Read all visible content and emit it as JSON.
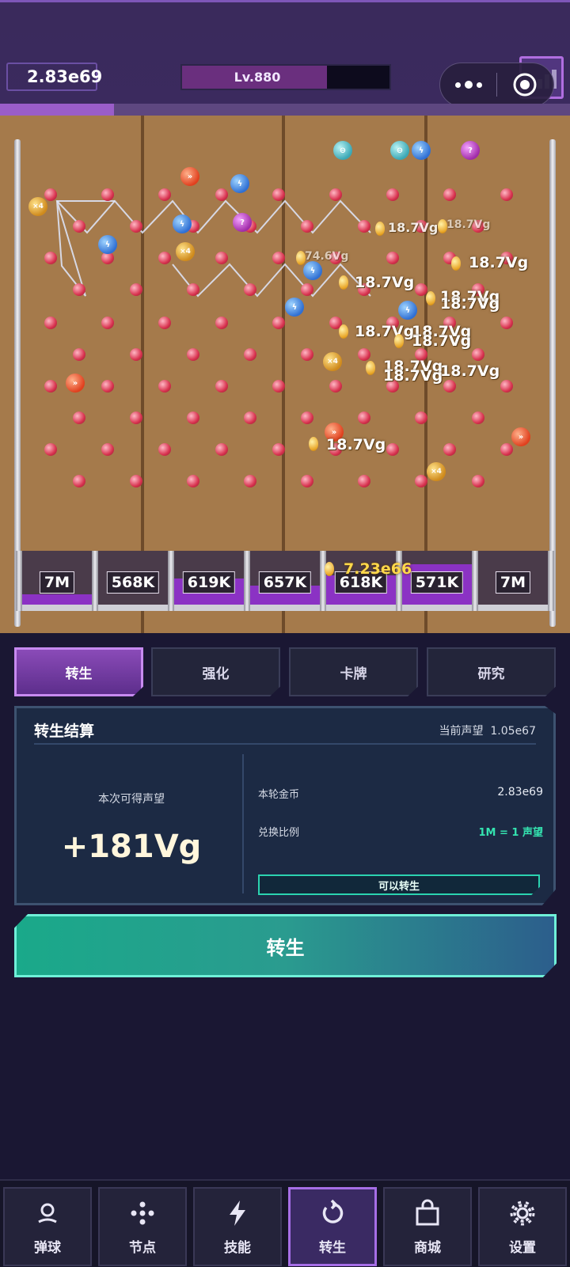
{
  "header": {
    "coins": "2.83e69",
    "level": "Lv.880",
    "level_progress": 0.7,
    "top_progress": 0.2
  },
  "board": {
    "floating_values": [
      "18.7Vg",
      "18.7Vg",
      "18.7Vg",
      "18.7Vg",
      "18.7Vg",
      "18.7Vg",
      "18.7Vg",
      "18.7Vg",
      "18.7Vg",
      "18.7Vg",
      "18.7Vg",
      "18.7Vg",
      "18.7Vg",
      "74.6Vg"
    ],
    "ball_multiplier": "×4",
    "jackpot": "7.23e66",
    "buckets": [
      {
        "label": "7M",
        "fill": 0.22
      },
      {
        "label": "568K",
        "fill": 0.0
      },
      {
        "label": "619K",
        "fill": 0.55
      },
      {
        "label": "657K",
        "fill": 0.4
      },
      {
        "label": "618K",
        "fill": 0.62
      },
      {
        "label": "571K",
        "fill": 0.85
      },
      {
        "label": "7M",
        "fill": 0.0
      }
    ]
  },
  "tabs": [
    {
      "label": "转生",
      "active": true
    },
    {
      "label": "强化",
      "active": false
    },
    {
      "label": "卡牌",
      "active": false
    },
    {
      "label": "研究",
      "active": false
    }
  ],
  "panel": {
    "title": "转生结算",
    "current_prestige_label": "当前声望",
    "current_prestige_value": "1.05e67",
    "gain_label": "本次可得声望",
    "gain_value": "+181Vg",
    "round_coins_label": "本轮金币",
    "round_coins_value": "2.83e69",
    "ratio_label": "兑换比例",
    "ratio_value": "1M = 1 声望",
    "status": "可以转生"
  },
  "rebirth_button": "转生",
  "nav": [
    {
      "label": "弹球",
      "icon": "pinball-icon"
    },
    {
      "label": "节点",
      "icon": "nodes-icon"
    },
    {
      "label": "技能",
      "icon": "lightning-icon"
    },
    {
      "label": "转生",
      "icon": "rebirth-icon",
      "active": true
    },
    {
      "label": "商城",
      "icon": "shop-bag-icon"
    },
    {
      "label": "设置",
      "icon": "gear-icon"
    }
  ],
  "colors": {
    "accent_purple": "#8b32c4",
    "accent_teal": "#2bd3b0",
    "board_wood": "#a57a4b",
    "peg_red": "#d8334f"
  }
}
